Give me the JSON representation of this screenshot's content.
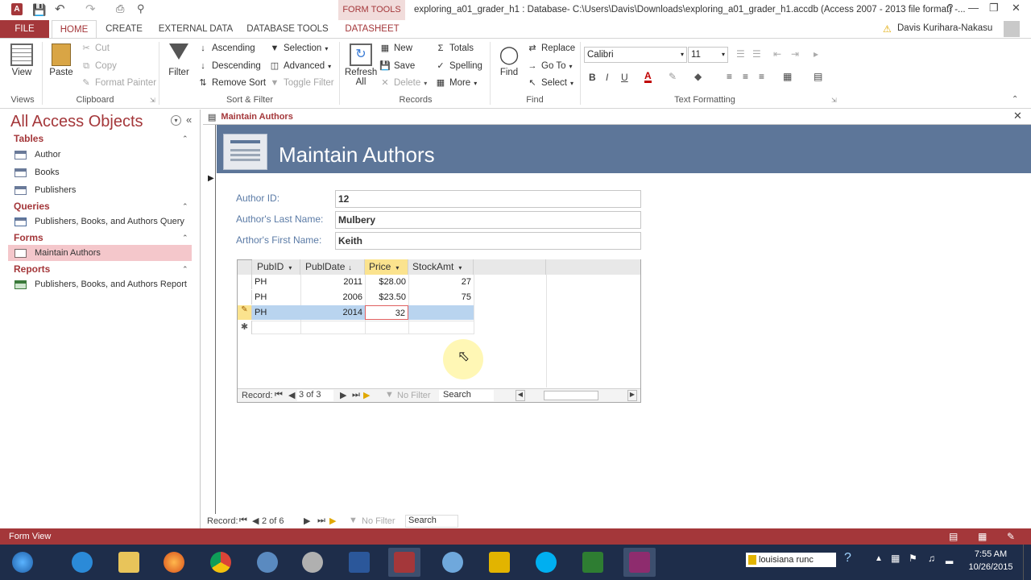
{
  "title_bar": {
    "app_icon_letter": "A",
    "contextual_tab": "FORM TOOLS",
    "window_title": "exploring_a01_grader_h1 : Database- C:\\Users\\Davis\\Downloads\\exploring_a01_grader_h1.accdb (Access 2007 - 2013 file format) -...",
    "help": "?",
    "minimize": "—",
    "restore": "❐",
    "close": "✕"
  },
  "ribbon_tabs": {
    "file": "FILE",
    "home": "HOME",
    "create": "CREATE",
    "external_data": "EXTERNAL DATA",
    "database_tools": "DATABASE TOOLS",
    "datasheet": "DATASHEET",
    "user_name": "Davis Kurihara-Nakasu"
  },
  "ribbon": {
    "views": {
      "view": "View",
      "group": "Views"
    },
    "clipboard": {
      "paste": "Paste",
      "cut": "Cut",
      "copy": "Copy",
      "format_painter": "Format Painter",
      "group": "Clipboard"
    },
    "sort_filter": {
      "filter": "Filter",
      "ascending": "Ascending",
      "descending": "Descending",
      "remove_sort": "Remove Sort",
      "selection": "Selection",
      "advanced": "Advanced",
      "toggle_filter": "Toggle Filter",
      "group": "Sort & Filter"
    },
    "records": {
      "refresh": "Refresh",
      "refresh_all": "All",
      "new": "New",
      "save": "Save",
      "delete": "Delete",
      "totals": "Totals",
      "spelling": "Spelling",
      "more": "More",
      "group": "Records"
    },
    "find": {
      "find": "Find",
      "replace": "Replace",
      "goto": "Go To",
      "select": "Select",
      "group": "Find"
    },
    "text_formatting": {
      "font": "Calibri",
      "size": "11",
      "bold": "B",
      "italic": "I",
      "underline": "U",
      "group": "Text Formatting"
    }
  },
  "nav_pane": {
    "title": "All Access Objects",
    "sections": [
      {
        "header": "Tables",
        "items": [
          "Author",
          "Books",
          "Publishers"
        ]
      },
      {
        "header": "Queries",
        "items": [
          "Publishers, Books, and Authors Query"
        ]
      },
      {
        "header": "Forms",
        "items": [
          "Maintain Authors"
        ]
      },
      {
        "header": "Reports",
        "items": [
          "Publishers, Books, and Authors Report"
        ]
      }
    ]
  },
  "document": {
    "tab_label": "Maintain Authors",
    "form_title": "Maintain Authors",
    "fields": [
      {
        "label": "Author ID:",
        "value": "12"
      },
      {
        "label": "Author's Last Name:",
        "value": "Mulbery"
      },
      {
        "label": "Arthor's First Name:",
        "value": "Keith"
      }
    ],
    "subform": {
      "columns": [
        "PubID",
        "PublDate",
        "Price",
        "StockAmt"
      ],
      "rows": [
        {
          "pubid": "PH",
          "date": "2011",
          "price": "$28.00",
          "stock": "27"
        },
        {
          "pubid": "PH",
          "date": "2006",
          "price": "$23.50",
          "stock": "75"
        },
        {
          "pubid": "PH",
          "date": "2014",
          "price": "32",
          "stock": ""
        }
      ],
      "record_label": "Record:",
      "record_position": "3 of 3",
      "no_filter": "No Filter",
      "search": "Search"
    },
    "main_record_label": "Record:",
    "main_record_position": "2 of 6",
    "main_no_filter": "No Filter",
    "main_search": "Search"
  },
  "status_bar": {
    "view": "Form View"
  },
  "taskbar": {
    "search_text": "louisiana runc",
    "time": "7:55 AM",
    "date": "10/26/2015"
  },
  "colors": {
    "access_red": "#a4373a",
    "form_header": "#5d7699",
    "label_blue": "#5b7ba6",
    "taskbar": "#1e2d4a"
  }
}
